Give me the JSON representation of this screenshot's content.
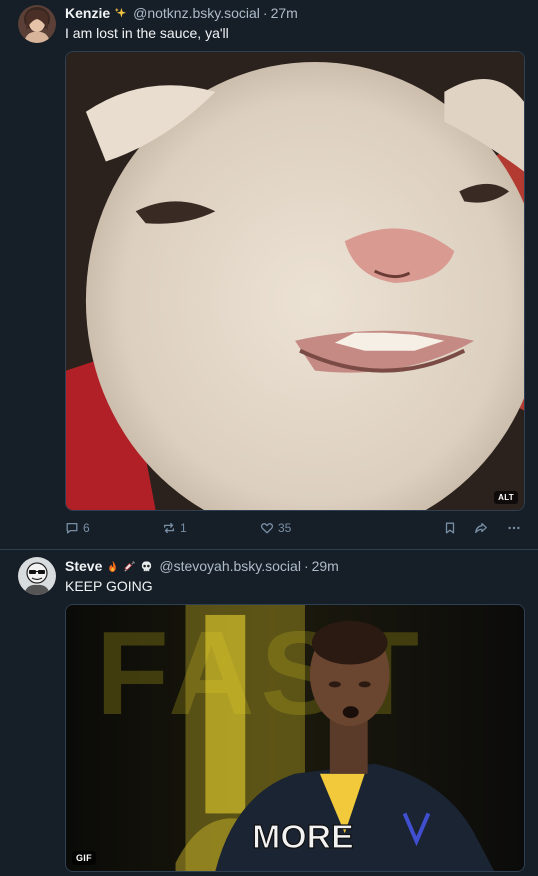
{
  "posts": [
    {
      "author": {
        "name": "Kenzie",
        "handle": "@notknz.bsky.social",
        "emoji_icons": [
          "sparkles-icon"
        ]
      },
      "time": "27m",
      "separator": "·",
      "text": "I am lost in the sauce, ya'll",
      "media": {
        "type": "image",
        "badge": "ALT"
      },
      "stats": {
        "replies": "6",
        "reposts": "1",
        "likes": "35"
      }
    },
    {
      "author": {
        "name": "Steve",
        "handle": "@stevoyah.bsky.social",
        "emoji_icons": [
          "fire-icon",
          "syringe-icon",
          "skull-icon"
        ]
      },
      "time": "29m",
      "separator": "·",
      "text": "KEEP GOING",
      "media": {
        "type": "gif",
        "badge": "GIF",
        "overlay_text": "MORE",
        "background_text": "FAST"
      }
    }
  ],
  "colors": {
    "background": "#161e27",
    "text": "#f1f3f5",
    "muted": "#aebbc9",
    "icon": "#788ea5",
    "divider": "#2e4052"
  }
}
